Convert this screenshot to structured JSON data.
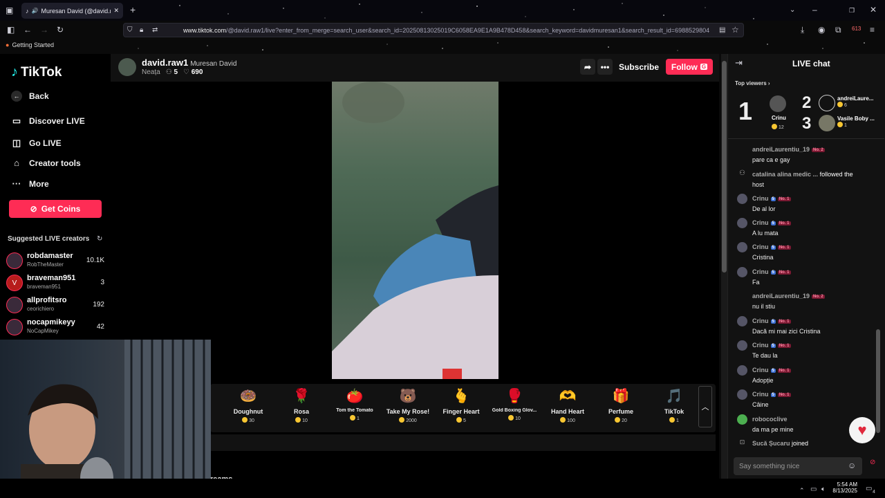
{
  "browser": {
    "tab_title": "Muresan David (@david.raw1",
    "url_domain": "www.tiktok.com",
    "url_rest": "/@david.raw1/live?enter_from_merge=search_user&search_id=20250813025019C6058EA9E1A9B478D458&search_keyword=davidmuresan1&search_result_id=6988529804",
    "bookmark": "Getting Started",
    "ext_badge": "613"
  },
  "sidebar": {
    "brand": "TikTok",
    "back": "Back",
    "items": [
      {
        "label": "Discover LIVE",
        "icon": "tv-icon"
      },
      {
        "label": "Go LIVE",
        "icon": "camera-icon"
      },
      {
        "label": "Creator tools",
        "icon": "lightbulb-icon"
      },
      {
        "label": "More",
        "icon": "more-dots-icon"
      }
    ],
    "get_coins": "Get Coins",
    "suggested_title": "Suggested LIVE creators",
    "creators": [
      {
        "name": "robdamaster",
        "handle": "RobTheMaster",
        "count": "10.1K"
      },
      {
        "name": "braveman951",
        "handle": "braveman951",
        "count": "3"
      },
      {
        "name": "allprofitsro",
        "handle": "ceorichiero",
        "count": "192"
      },
      {
        "name": "nocapmikeyy",
        "handle": "NoCapMikey",
        "count": "42"
      }
    ]
  },
  "header": {
    "username": "david.raw1",
    "display_name": "Muresan David",
    "title": "Neața",
    "viewers": "5",
    "likes": "690",
    "subscribe": "Subscribe",
    "follow": "Follow",
    "follow_badge": "G"
  },
  "gifts": [
    {
      "name": "Doughnut",
      "price": "30",
      "icon": "🍩"
    },
    {
      "name": "Rosa",
      "price": "10",
      "icon": "🌹"
    },
    {
      "name": "Tom the Tomato",
      "price": "1",
      "icon": "🍅"
    },
    {
      "name": "Take My Rose!",
      "price": "2000",
      "icon": "🐻"
    },
    {
      "name": "Finger Heart",
      "price": "5",
      "icon": "🫰"
    },
    {
      "name": "Gold Boxing Glov...",
      "price": "10",
      "icon": "🥊"
    },
    {
      "name": "Hand Heart",
      "price": "100",
      "icon": "🫶"
    },
    {
      "name": "Perfume",
      "price": "20",
      "icon": "🎁"
    },
    {
      "name": "TikTok",
      "price": "1",
      "icon": "🎵"
    }
  ],
  "bottom_partial": "reams",
  "chat": {
    "title": "LIVE chat",
    "top_viewers_label": "Top viewers",
    "top": [
      {
        "rank": "1",
        "name": "Crinu",
        "coins": "12"
      },
      {
        "rank": "2",
        "name": "andreiLaure...",
        "coins": "6"
      },
      {
        "rank": "3",
        "name": "Vasile Boby ...",
        "coins": "1"
      }
    ],
    "messages": [
      {
        "user": "andreiLaurentiu_19",
        "lvl": "",
        "no": "No. 2",
        "text": "pare ca e gay"
      },
      {
        "user": "catalina alina medic ...",
        "lvl": "",
        "no": "",
        "text": "host",
        "action": "followed the"
      },
      {
        "user": "Crinu",
        "lvl": "5",
        "no": "No. 1",
        "text": "De al lor"
      },
      {
        "user": "Crinu",
        "lvl": "5",
        "no": "No. 1",
        "text": "A lu mata"
      },
      {
        "user": "Crinu",
        "lvl": "5",
        "no": "No. 1",
        "text": "Cristina"
      },
      {
        "user": "Crinu",
        "lvl": "5",
        "no": "No. 1",
        "text": "Fa"
      },
      {
        "user": "andreiLaurentiu_19",
        "lvl": "",
        "no": "No. 2",
        "text": "nu il stiu"
      },
      {
        "user": "Crinu",
        "lvl": "5",
        "no": "No. 1",
        "text": "Dacă mi mai zici Cristina"
      },
      {
        "user": "Crinu",
        "lvl": "5",
        "no": "No. 1",
        "text": "Te dau la"
      },
      {
        "user": "Crinu",
        "lvl": "5",
        "no": "No. 1",
        "text": "Adopție"
      },
      {
        "user": "Crinu",
        "lvl": "5",
        "no": "No. 1",
        "text": "Câine"
      },
      {
        "user": "robococlive",
        "lvl": "",
        "no": "",
        "text": "da ma pe mine"
      }
    ],
    "join_user": "Sucă Șucaru",
    "join_text": "joined",
    "input_placeholder": "Say something nice"
  },
  "taskbar": {
    "time": "5:54 AM",
    "date": "8/13/2025",
    "notif": "4"
  }
}
